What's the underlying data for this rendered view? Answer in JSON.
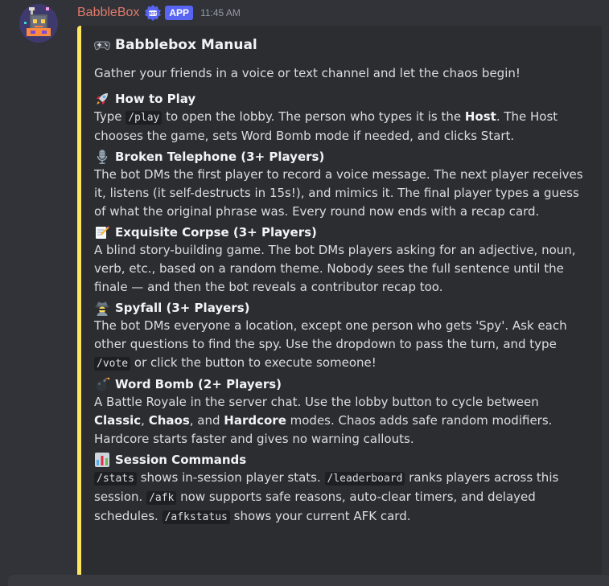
{
  "message": {
    "author": "BabbleBox",
    "app_tag": "APP",
    "timestamp": "11:45 AM",
    "avatar_icon": "robot-avatar-icon",
    "verified_icon": "bot-verified-badge-icon"
  },
  "embed": {
    "accent_color": "#fee75c",
    "title_emoji": "game-controller-icon",
    "title": "Babblebox Manual",
    "intro": "Gather your friends in a voice or text channel and let the chaos begin!",
    "sections": [
      {
        "emoji": "rocket-icon",
        "title": "How to Play",
        "parts": [
          {
            "t": "text",
            "v": "Type "
          },
          {
            "t": "code",
            "v": "/play"
          },
          {
            "t": "text",
            "v": " to open the lobby. The person who types it is the "
          },
          {
            "t": "bold",
            "v": "Host"
          },
          {
            "t": "text",
            "v": ". The Host chooses the game, sets Word Bomb mode if needed, and clicks Start."
          }
        ]
      },
      {
        "emoji": "microphone-icon",
        "title": "Broken Telephone (3+ Players)",
        "parts": [
          {
            "t": "text",
            "v": "The bot DMs the first player to record a voice message. The next player receives it, listens (it self-destructs in 15s!), and mimics it. The final player types a guess of what the original phrase was. Every round now ends with a recap card."
          }
        ]
      },
      {
        "emoji": "memo-icon",
        "title": "Exquisite Corpse (3+ Players)",
        "parts": [
          {
            "t": "text",
            "v": "A blind story-building game. The bot DMs players asking for an adjective, noun, verb, etc., based on a random theme. Nobody sees the full sentence until the finale — and then the bot reveals a contributor recap too."
          }
        ]
      },
      {
        "emoji": "detective-icon",
        "title": "Spyfall (3+ Players)",
        "parts": [
          {
            "t": "text",
            "v": "The bot DMs everyone a location, except one person who gets 'Spy'. Ask each other questions to find the spy. Use the dropdown to pass the turn, and type "
          },
          {
            "t": "code",
            "v": "/vote"
          },
          {
            "t": "text",
            "v": " or click the button to execute someone!"
          }
        ]
      },
      {
        "emoji": "bomb-icon",
        "title": "Word Bomb (2+ Players)",
        "parts": [
          {
            "t": "text",
            "v": "A Battle Royale in the server chat. Use the lobby button to cycle between "
          },
          {
            "t": "bold",
            "v": "Classic"
          },
          {
            "t": "text",
            "v": ", "
          },
          {
            "t": "bold",
            "v": "Chaos"
          },
          {
            "t": "text",
            "v": ", and "
          },
          {
            "t": "bold",
            "v": "Hardcore"
          },
          {
            "t": "text",
            "v": " modes. Chaos adds safe random modifiers. Hardcore starts faster and gives no warning callouts."
          }
        ]
      },
      {
        "emoji": "bar-chart-icon",
        "title": "Session Commands",
        "parts": [
          {
            "t": "code",
            "v": "/stats"
          },
          {
            "t": "text",
            "v": " shows in-session player stats. "
          },
          {
            "t": "code",
            "v": "/leaderboard"
          },
          {
            "t": "text",
            "v": " ranks players across this session. "
          },
          {
            "t": "code",
            "v": "/afk"
          },
          {
            "t": "text",
            "v": " now supports safe reasons, auto-clear timers, and delayed schedules. "
          },
          {
            "t": "code",
            "v": "/afkstatus"
          },
          {
            "t": "text",
            "v": " shows your current AFK card."
          }
        ]
      }
    ]
  }
}
